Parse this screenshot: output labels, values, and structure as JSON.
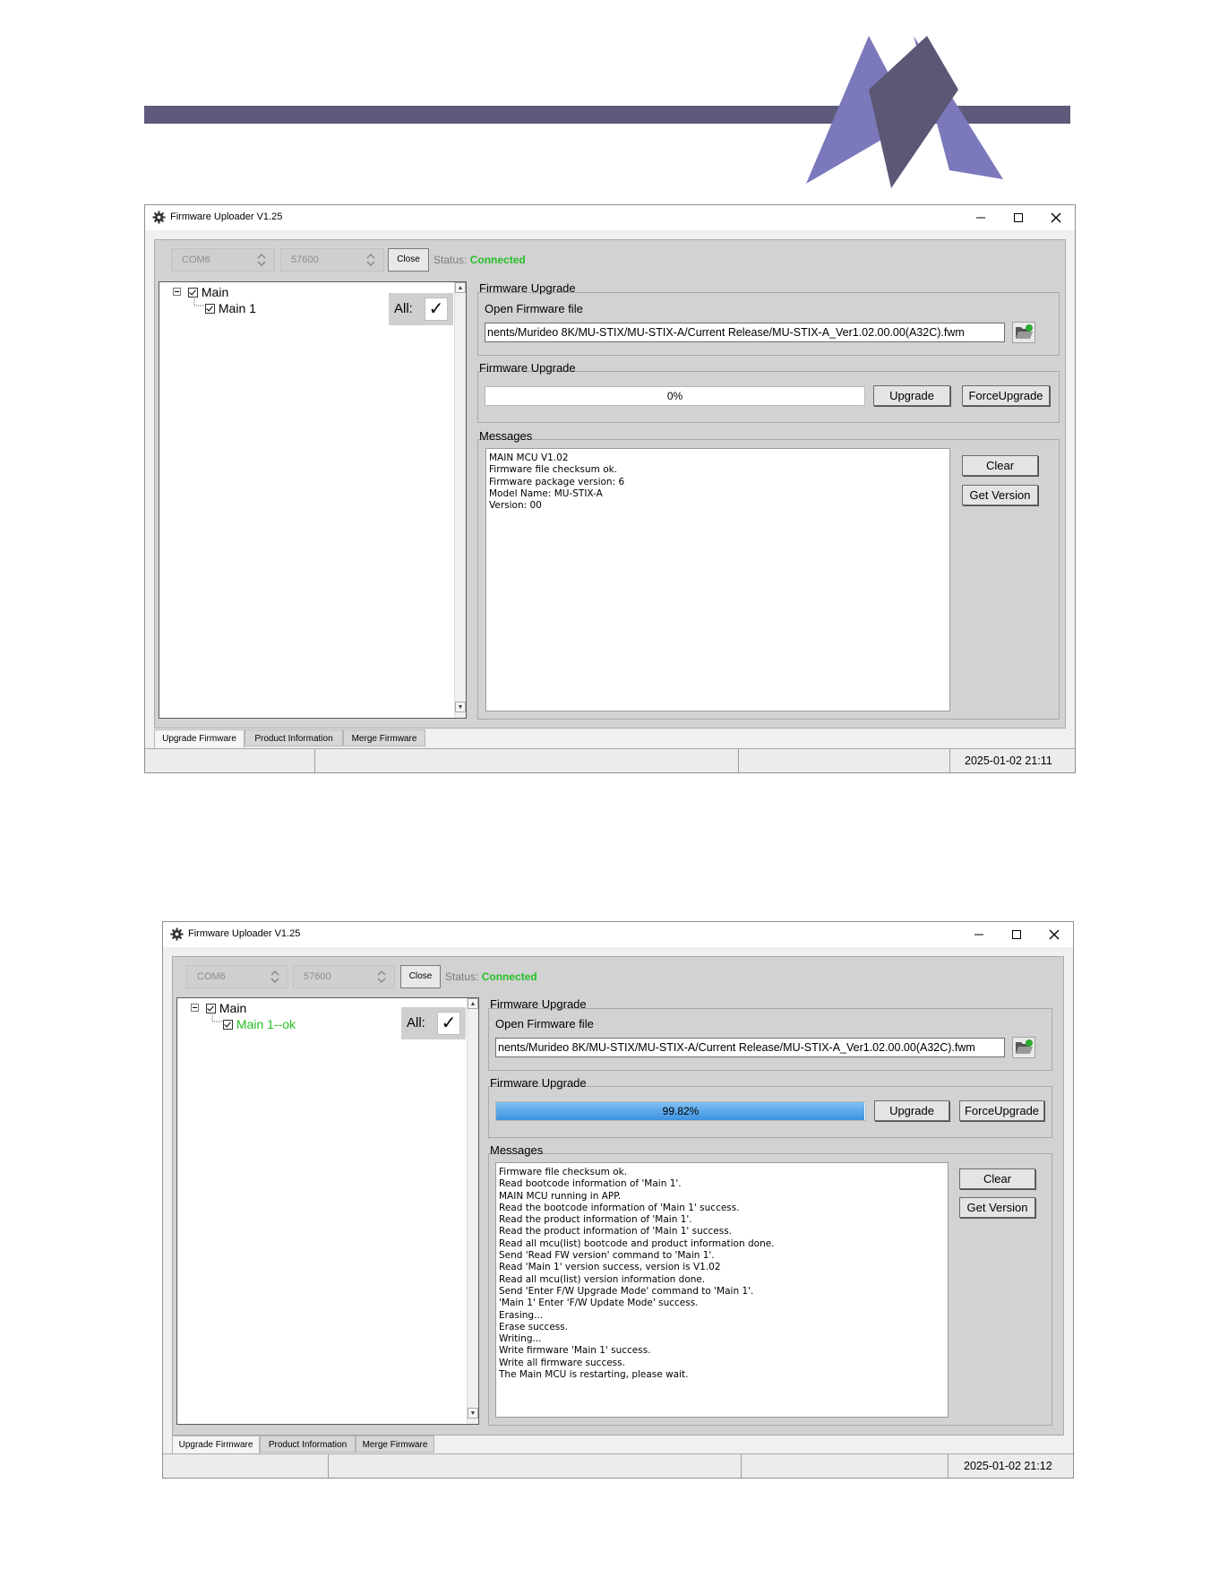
{
  "brand": {
    "band_color": "#5d5a7b",
    "logo_dark": "#5b5774",
    "logo_light": "#7b78bb"
  },
  "colors": {
    "connected": "#25c026",
    "ok_text": "#25c026",
    "progress_fill": "#3d92e0"
  },
  "window1": {
    "title": "Firmware Uploader V1.25",
    "port": "COM6",
    "baud": "57600",
    "close_label": "Close",
    "status_label": "Status:",
    "status_value": "Connected",
    "tree_root": "Main",
    "tree_child": "Main 1",
    "all_label": "All:",
    "all_check": "✓",
    "group_file_title": "Firmware Upgrade",
    "open_file_label": "Open Firmware file",
    "file_path": "nents/Murideo 8K/MU-STIX/MU-STIX-A/Current Release/MU-STIX-A_Ver1.02.00.00(A32C).fwm",
    "group_upgrade_title": "Firmware Upgrade",
    "progress": 0,
    "progress_text": "0%",
    "upgrade_label": "Upgrade",
    "force_label": "ForceUpgrade",
    "messages_title": "Messages",
    "clear_label": "Clear",
    "getversion_label": "Get Version",
    "messages": [
      "MAIN MCU V1.02",
      "Firmware file checksum ok.",
      "Firmware package version: 6",
      "Model Name: MU-STIX-A",
      "Version: 00"
    ],
    "tabs": [
      "Upgrade Firmware",
      "Product Information",
      "Merge Firmware"
    ],
    "timestamp": "2025-01-02 21:11"
  },
  "window2": {
    "title": "Firmware Uploader V1.25",
    "port": "COM6",
    "baud": "57600",
    "close_label": "Close",
    "status_label": "Status:",
    "status_value": "Connected",
    "tree_root": "Main",
    "tree_child": "Main 1--ok",
    "all_label": "All:",
    "all_check": "✓",
    "group_file_title": "Firmware Upgrade",
    "open_file_label": "Open Firmware file",
    "file_path": "nents/Murideo 8K/MU-STIX/MU-STIX-A/Current Release/MU-STIX-A_Ver1.02.00.00(A32C).fwm",
    "group_upgrade_title": "Firmware Upgrade",
    "progress": 99.82,
    "progress_text": "99.82%",
    "upgrade_label": "Upgrade",
    "force_label": "ForceUpgrade",
    "messages_title": "Messages",
    "clear_label": "Clear",
    "getversion_label": "Get Version",
    "messages": [
      "Firmware file checksum ok.",
      "Read bootcode information of 'Main 1'.",
      "MAIN MCU running in APP.",
      "Read the bootcode information of 'Main 1' success.",
      "Read the product information of 'Main 1'.",
      "Read the product information of 'Main 1'  success.",
      "Read all mcu(list) bootcode and product information done.",
      "Send 'Read FW version' command to 'Main 1'.",
      "Read 'Main 1' version success, version is V1.02",
      "Read all mcu(list) version information done.",
      "Send 'Enter F/W Upgrade Mode' command to 'Main 1'.",
      "'Main 1' Enter 'F/W Update Mode' success.",
      "Erasing...",
      "Erase success.",
      "Writing...",
      "Write firmware 'Main 1' success.",
      "Write all firmware success.",
      "The Main MCU is restarting, please wait."
    ],
    "tabs": [
      "Upgrade Firmware",
      "Product Information",
      "Merge Firmware"
    ],
    "timestamp": "2025-01-02 21:12"
  }
}
